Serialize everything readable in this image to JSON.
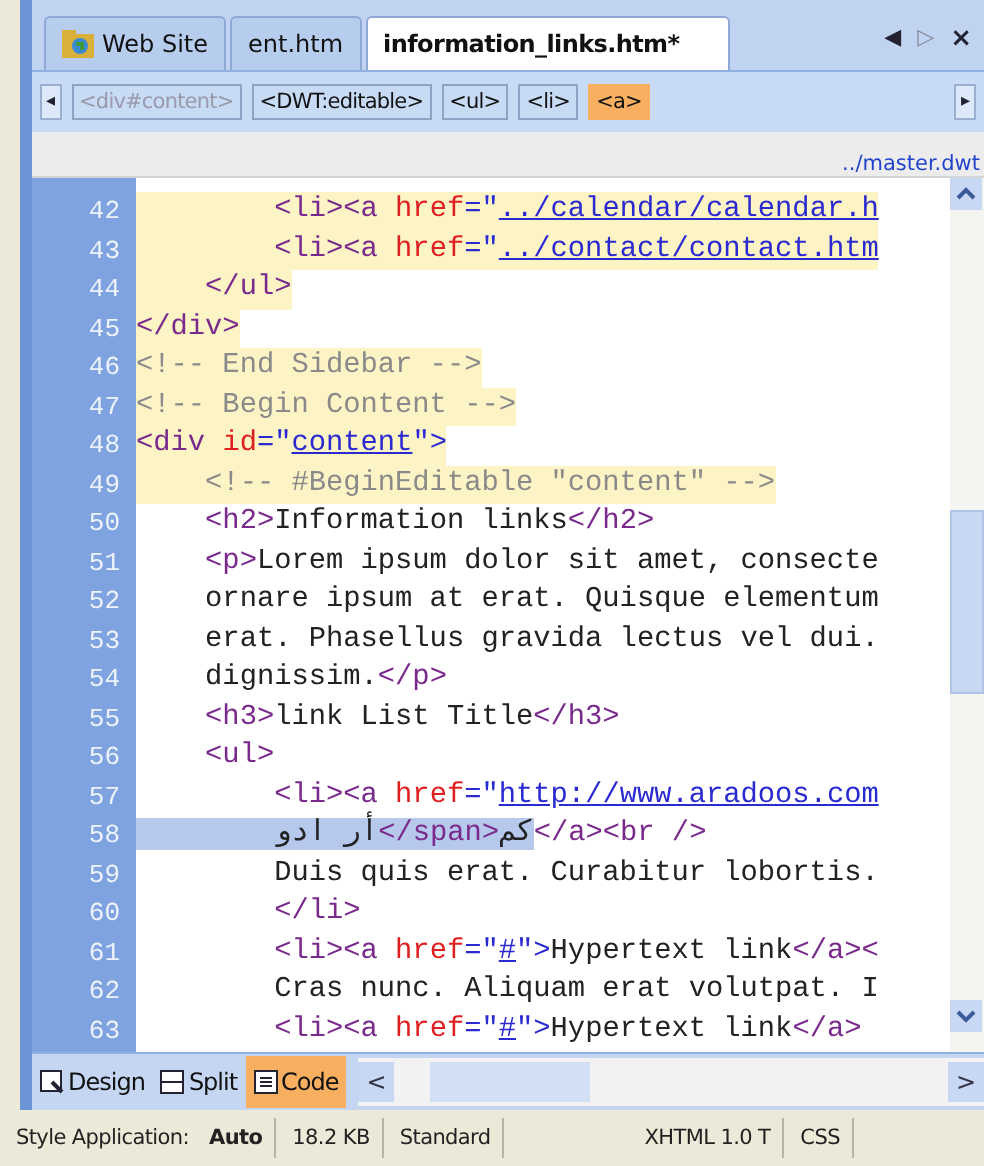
{
  "tabs": [
    {
      "label": "Web Site",
      "kind": "site",
      "selected": false
    },
    {
      "label": "ent.htm",
      "kind": "file",
      "selected": false
    },
    {
      "label": "information_links.htm*",
      "kind": "file",
      "selected": true
    }
  ],
  "tab_controls": {
    "scroll_left": "◀",
    "scroll_right": "▷",
    "close": "×"
  },
  "breadcrumb": {
    "scroll_left": "◂",
    "scroll_right": "▸",
    "items": [
      {
        "label": "<div#content>",
        "disabled": true,
        "selected": false
      },
      {
        "label": "<DWT:editable>",
        "disabled": false,
        "selected": false
      },
      {
        "label": "<ul>",
        "disabled": false,
        "selected": false
      },
      {
        "label": "<li>",
        "disabled": false,
        "selected": false
      },
      {
        "label": "<a>",
        "disabled": false,
        "selected": true
      }
    ]
  },
  "template_path": "../master.dwt",
  "code_lines": [
    {
      "number": "42",
      "highlighted": true,
      "tokens": [
        {
          "kind": "tag",
          "text": "        <li><a "
        },
        {
          "kind": "attr",
          "text": "href"
        },
        {
          "kind": "punct",
          "text": "=\""
        },
        {
          "kind": "value",
          "text": "../calendar/calendar.h"
        }
      ]
    },
    {
      "number": "43",
      "highlighted": true,
      "tokens": [
        {
          "kind": "tag",
          "text": "        <li><a "
        },
        {
          "kind": "attr",
          "text": "href"
        },
        {
          "kind": "punct",
          "text": "=\""
        },
        {
          "kind": "value",
          "text": "../contact/contact.htm"
        }
      ]
    },
    {
      "number": "44",
      "highlighted": true,
      "tokens": [
        {
          "kind": "tag",
          "text": "    </ul>"
        }
      ]
    },
    {
      "number": "45",
      "highlighted": true,
      "tokens": [
        {
          "kind": "tag",
          "text": "</div>"
        }
      ]
    },
    {
      "number": "46",
      "highlighted": true,
      "tokens": [
        {
          "kind": "comment",
          "text": "<!-- End Sidebar -->"
        }
      ]
    },
    {
      "number": "47",
      "highlighted": true,
      "tokens": [
        {
          "kind": "comment",
          "text": "<!-- Begin Content -->"
        }
      ]
    },
    {
      "number": "48",
      "highlighted": true,
      "tokens": [
        {
          "kind": "tag",
          "text": "<div "
        },
        {
          "kind": "attr",
          "text": "id"
        },
        {
          "kind": "punct",
          "text": "=\""
        },
        {
          "kind": "value",
          "text": "content"
        },
        {
          "kind": "punct",
          "text": "\">"
        }
      ]
    },
    {
      "number": "49",
      "highlighted": true,
      "tokens": [
        {
          "kind": "comment",
          "text": "    <!-- #BeginEditable \"content\" -->"
        }
      ]
    },
    {
      "number": "50",
      "highlighted": false,
      "tokens": [
        {
          "kind": "tag",
          "text": "    <h2>"
        },
        {
          "kind": "text",
          "text": "Information links"
        },
        {
          "kind": "tag",
          "text": "</h2>"
        }
      ]
    },
    {
      "number": "51",
      "highlighted": false,
      "tokens": [
        {
          "kind": "tag",
          "text": "    <p>"
        },
        {
          "kind": "text",
          "text": "Lorem ipsum dolor sit amet, consecte"
        }
      ]
    },
    {
      "number": "52",
      "highlighted": false,
      "tokens": [
        {
          "kind": "text",
          "text": "    ornare ipsum at erat. Quisque elementum"
        }
      ]
    },
    {
      "number": "53",
      "highlighted": false,
      "tokens": [
        {
          "kind": "text",
          "text": "    erat. Phasellus gravida lectus vel dui."
        }
      ]
    },
    {
      "number": "54",
      "highlighted": false,
      "tokens": [
        {
          "kind": "text",
          "text": "    dignissim."
        },
        {
          "kind": "tag",
          "text": "</p>"
        }
      ]
    },
    {
      "number": "55",
      "highlighted": false,
      "tokens": [
        {
          "kind": "tag",
          "text": "    <h3>"
        },
        {
          "kind": "text",
          "text": "link List Title"
        },
        {
          "kind": "tag",
          "text": "</h3>"
        }
      ]
    },
    {
      "number": "56",
      "highlighted": false,
      "tokens": [
        {
          "kind": "tag",
          "text": "    <ul>"
        }
      ]
    },
    {
      "number": "57",
      "highlighted": false,
      "tokens": [
        {
          "kind": "tag",
          "text": "        <li><a "
        },
        {
          "kind": "attr",
          "text": "href"
        },
        {
          "kind": "punct",
          "text": "=\""
        },
        {
          "kind": "value",
          "text": "http://www.aradoos.com"
        }
      ]
    },
    {
      "number": "58",
      "highlighted": false,
      "tokens": [
        {
          "kind": "text",
          "text": "        أر ادو",
          "selected": true
        },
        {
          "kind": "tag",
          "text": "</span>",
          "selected": true
        },
        {
          "kind": "text",
          "text": "کم",
          "selected": true
        },
        {
          "kind": "tag",
          "text": "</a><br />",
          "selected": false
        }
      ]
    },
    {
      "number": "59",
      "highlighted": false,
      "tokens": [
        {
          "kind": "text",
          "text": "        Duis quis erat. Curabitur lobortis."
        }
      ]
    },
    {
      "number": "60",
      "highlighted": false,
      "tokens": [
        {
          "kind": "tag",
          "text": "        </li>"
        }
      ]
    },
    {
      "number": "61",
      "highlighted": false,
      "tokens": [
        {
          "kind": "tag",
          "text": "        <li><a "
        },
        {
          "kind": "attr",
          "text": "href"
        },
        {
          "kind": "punct",
          "text": "=\""
        },
        {
          "kind": "value",
          "text": "#"
        },
        {
          "kind": "punct",
          "text": "\">"
        },
        {
          "kind": "text",
          "text": "Hypertext link"
        },
        {
          "kind": "tag",
          "text": "</a><"
        }
      ]
    },
    {
      "number": "62",
      "highlighted": false,
      "tokens": [
        {
          "kind": "text",
          "text": "        Cras nunc. Aliquam erat volutpat. I"
        }
      ]
    },
    {
      "number": "63",
      "highlighted": false,
      "tokens": [
        {
          "kind": "tag",
          "text": "        <li><a "
        },
        {
          "kind": "attr",
          "text": "href"
        },
        {
          "kind": "punct",
          "text": "=\""
        },
        {
          "kind": "value",
          "text": "#"
        },
        {
          "kind": "punct",
          "text": "\">"
        },
        {
          "kind": "text",
          "text": "Hypertext link"
        },
        {
          "kind": "tag",
          "text": "</a>"
        }
      ]
    }
  ],
  "view_tabs": [
    {
      "label": "Design",
      "kind": "design",
      "selected": false
    },
    {
      "label": "Split",
      "kind": "split",
      "selected": false
    },
    {
      "label": "Code",
      "kind": "code",
      "selected": true
    }
  ],
  "hscroll": {
    "left": "<",
    "right": ">"
  },
  "status_bar": [
    {
      "label": "Style Application:",
      "value": "Auto"
    },
    {
      "label": "18.2 KB"
    },
    {
      "label": "Standard"
    },
    {
      "label": "XHTML 1.0 T"
    },
    {
      "label": "CSS"
    }
  ]
}
